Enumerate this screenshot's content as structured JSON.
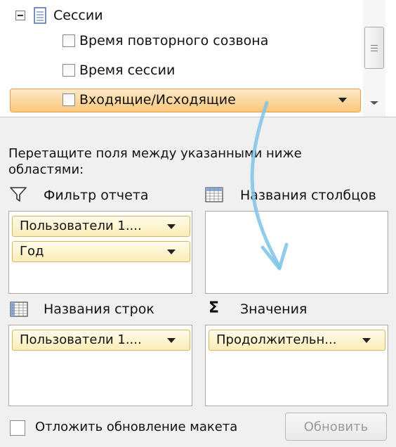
{
  "field_list": {
    "table_name": "Сессии",
    "fields": [
      {
        "label": "Время повторного созвона",
        "checked": false
      },
      {
        "label": "Время сессии",
        "checked": false
      },
      {
        "label": "Входящие/Исходящие",
        "checked": false,
        "selected": true
      }
    ]
  },
  "instruction": "Перетащите поля между указанными ниже областями:",
  "areas": {
    "filter": {
      "title": "Фильтр отчета",
      "icon": "filter-icon",
      "items": [
        "Пользователи 1....",
        "Год"
      ]
    },
    "columns": {
      "title": "Названия столбцов",
      "icon": "column-grid-icon",
      "items": []
    },
    "rows": {
      "title": "Названия строк",
      "icon": "row-grid-icon",
      "items": [
        "Пользователи 1...."
      ]
    },
    "values": {
      "title": "Значения",
      "icon": "sigma-icon",
      "items": [
        "Продолжительн..."
      ]
    }
  },
  "footer": {
    "defer_label": "Отложить обновление макета",
    "defer_checked": false,
    "update_button": "Обновить",
    "update_enabled": false
  },
  "colors": {
    "selected_row": "#f9c77a",
    "chip_background": "#fbedb7",
    "annotation_arrow": "#7ec3e6"
  }
}
